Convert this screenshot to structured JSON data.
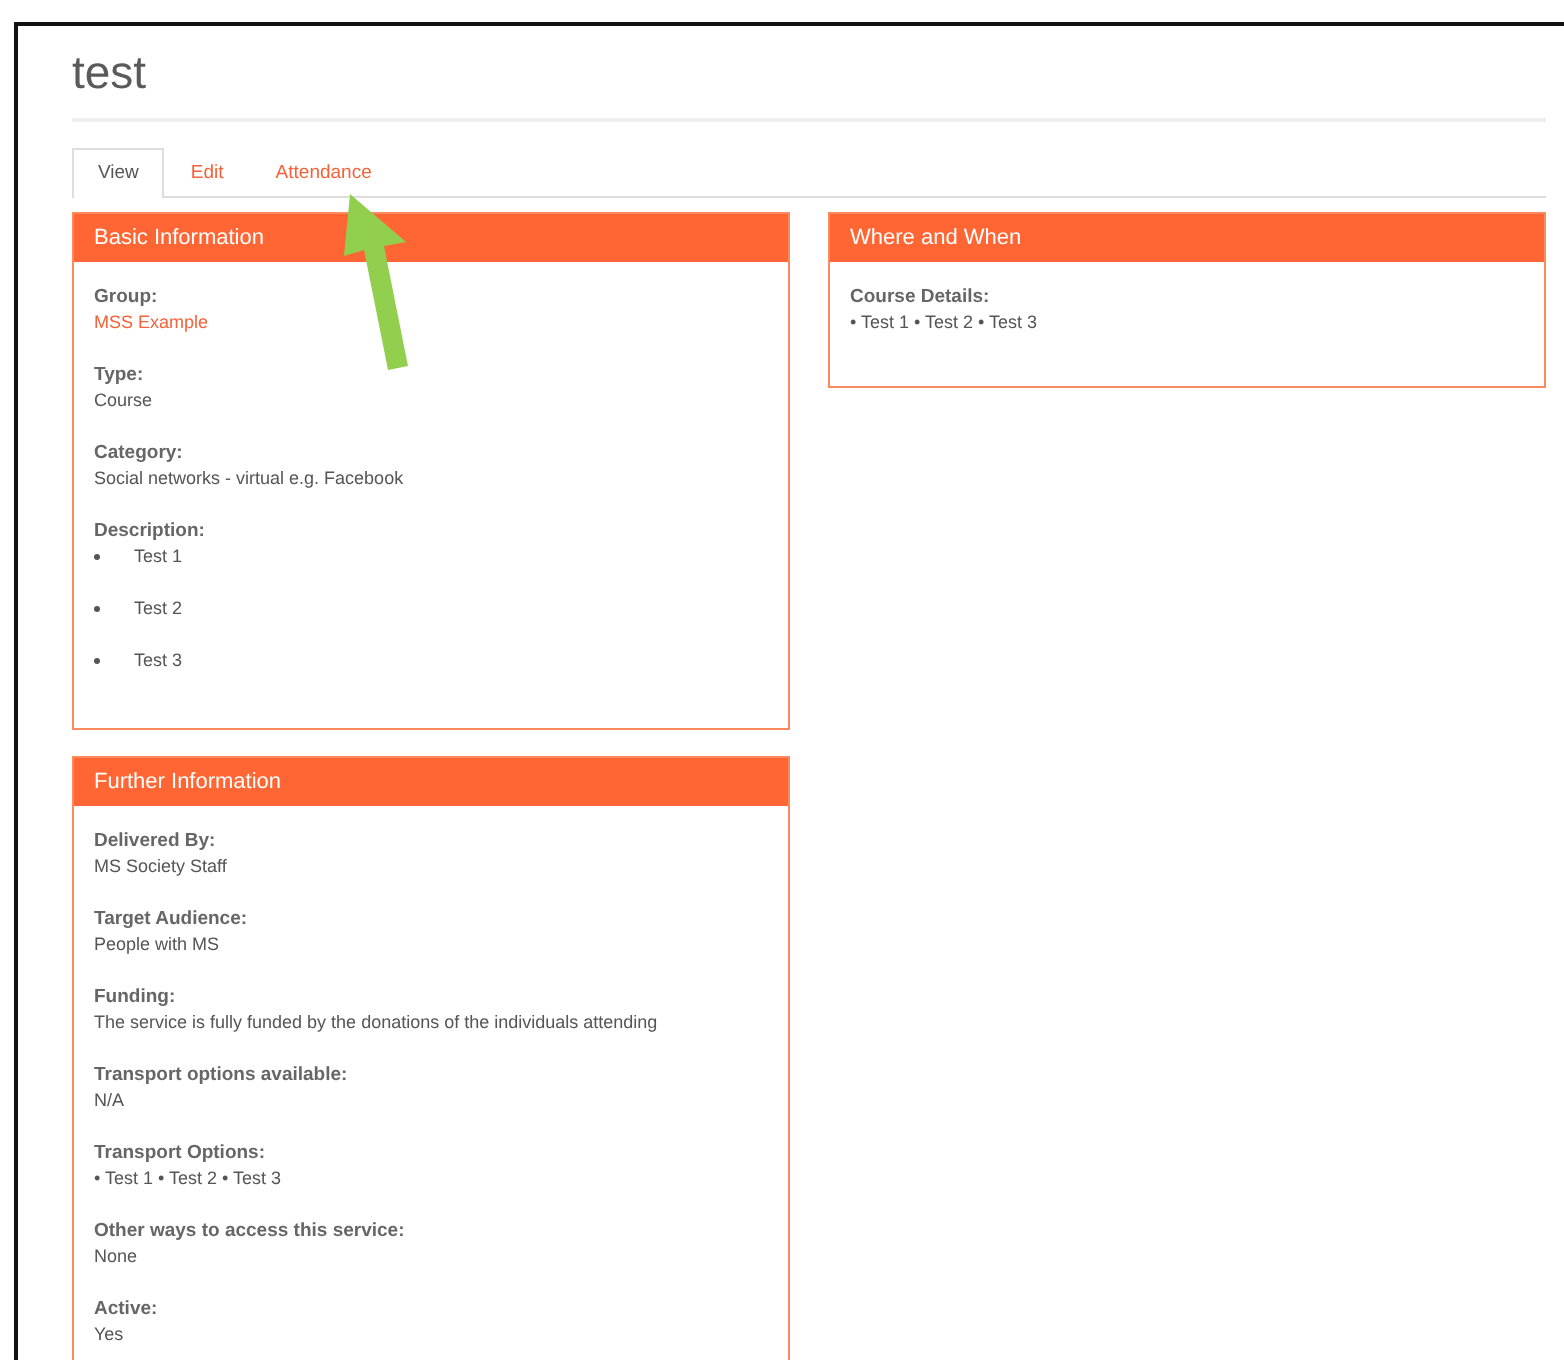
{
  "page": {
    "title": "test"
  },
  "tabs": [
    {
      "label": "View",
      "selected": true
    },
    {
      "label": "Edit",
      "selected": false
    },
    {
      "label": "Attendance",
      "selected": false
    }
  ],
  "columns": [
    [
      {
        "title": "Basic Information",
        "fields": [
          {
            "label": "Group:",
            "kind": "link",
            "value": "MSS Example"
          },
          {
            "label": "Type:",
            "kind": "text",
            "value": "Course"
          },
          {
            "label": "Category:",
            "kind": "text",
            "value": "Social networks - virtual e.g. Facebook"
          },
          {
            "label": "Description:",
            "kind": "bullets",
            "items": [
              "Test 1",
              "Test 2",
              "Test 3"
            ]
          }
        ]
      },
      {
        "title": "Further Information",
        "fields": [
          {
            "label": "Delivered By:",
            "kind": "text",
            "value": "MS Society Staff"
          },
          {
            "label": "Target Audience:",
            "kind": "text",
            "value": "People with MS"
          },
          {
            "label": "Funding:",
            "kind": "text",
            "value": "The service is fully funded by the donations of the individuals attending"
          },
          {
            "label": "Transport options available:",
            "kind": "text",
            "value": "N/A"
          },
          {
            "label": "Transport Options:",
            "kind": "text",
            "value": "• Test 1 • Test 2 • Test 3"
          },
          {
            "label": "Other ways to access this service:",
            "kind": "text",
            "value": "None"
          },
          {
            "label": "Active:",
            "kind": "text",
            "value": "Yes"
          }
        ]
      }
    ],
    [
      {
        "title": "Where and When",
        "fields": [
          {
            "label": "Course Details:",
            "kind": "text",
            "value": "• Test 1 • Test 2 • Test 3"
          }
        ]
      }
    ]
  ]
}
